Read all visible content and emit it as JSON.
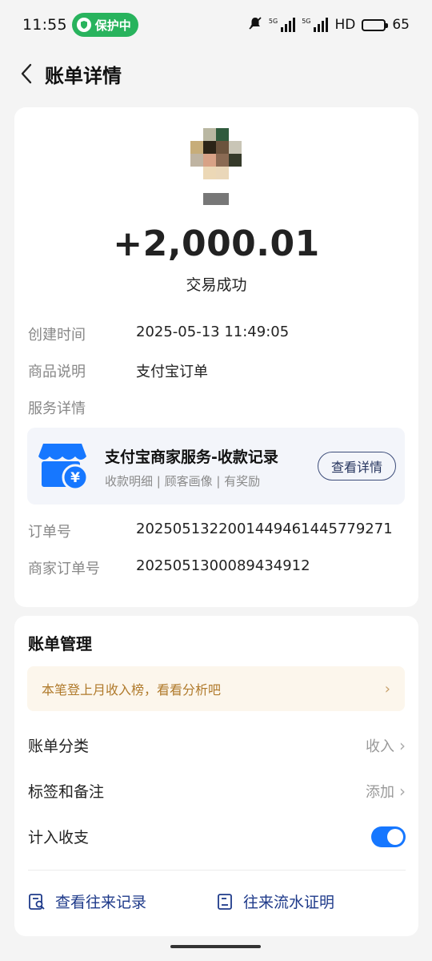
{
  "status_bar": {
    "time": "11:55",
    "protect_label": "保护中",
    "network_label": "HD",
    "battery_level": "65"
  },
  "nav": {
    "title": "账单详情"
  },
  "transaction": {
    "amount": "+2,000.01",
    "status": "交易成功",
    "created_label": "创建时间",
    "created_value": "2025-05-13 11:49:05",
    "product_label": "商品说明",
    "product_value": "支付宝订单",
    "service_label": "服务详情",
    "order_label": "订单号",
    "order_value": "2025051322001449461445779271",
    "merchant_order_label": "商家订单号",
    "merchant_order_value": "2025051300089434912"
  },
  "service_card": {
    "title": "支付宝商家服务-收款记录",
    "subtitle": "收款明细 | 顾客画像 | 有奖励",
    "button_label": "查看详情",
    "icon_color": "#1677ff"
  },
  "management": {
    "title": "账单管理",
    "tip": "本笔登上月收入榜，看看分析吧",
    "category_label": "账单分类",
    "category_value": "收入",
    "tags_label": "标签和备注",
    "tags_value": "添加",
    "include_label": "计入收支",
    "include_enabled": true,
    "link_history": "查看往来记录",
    "link_proof": "往来流水证明"
  },
  "colors": {
    "accent": "#1677ff",
    "protect_green": "#28b35d",
    "tip_text": "#b07a2b",
    "link": "#1e3a8a"
  }
}
